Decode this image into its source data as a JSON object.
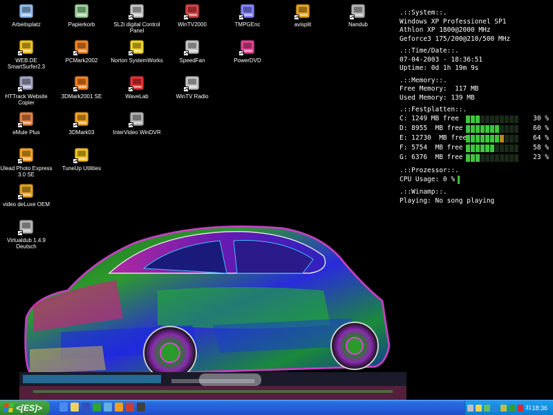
{
  "desktop_icons": [
    {
      "label": "Arbeitsplatz",
      "icon": "my-computer-icon",
      "color": "#8fb8e8"
    },
    {
      "label": "Papierkorb",
      "icon": "recycle-bin-icon",
      "color": "#9ad09a"
    },
    {
      "label": "SL2i digital Control Panel",
      "icon": "control-panel-icon",
      "color": "#c0c0c0"
    },
    {
      "label": "WinTV2000",
      "icon": "wintv-icon",
      "color": "#d04040"
    },
    {
      "label": "TMPGEnc",
      "icon": "tmpgenc-icon",
      "color": "#8080ff"
    },
    {
      "label": "avisplit",
      "icon": "avisplit-icon",
      "color": "#e0a020"
    },
    {
      "label": "Nandub",
      "icon": "nandub-icon",
      "color": "#b0b0b0"
    },
    {
      "label": "WEB.DE SmartSurfer2.3",
      "icon": "smartsurfer-icon",
      "color": "#f0c020"
    },
    {
      "label": "PCMark2002",
      "icon": "pcmark-icon",
      "color": "#f08020"
    },
    {
      "label": "Norton SystemWorks",
      "icon": "norton-icon",
      "color": "#f0d020"
    },
    {
      "label": "SpeedFan",
      "icon": "speedfan-icon",
      "color": "#c0c0c0"
    },
    {
      "label": "PowerDVD",
      "icon": "powerdvd-icon",
      "color": "#e04090"
    },
    {
      "label": "HTTrack Website Copier",
      "icon": "httrack-icon",
      "color": "#a0a0c0"
    },
    {
      "label": "3DMark2001 SE",
      "icon": "3dmark2001-icon",
      "color": "#f08020"
    },
    {
      "label": "WaveLab",
      "icon": "wavelab-icon",
      "color": "#e03030"
    },
    {
      "label": "WinTV Radio",
      "icon": "wintv-radio-icon",
      "color": "#c0c0c0"
    },
    {
      "label": "eMule Plus",
      "icon": "emule-icon",
      "color": "#e08040"
    },
    {
      "label": "3DMark03",
      "icon": "3dmark03-icon",
      "color": "#f0a020"
    },
    {
      "label": "InterVideo WinDVR",
      "icon": "windvr-icon",
      "color": "#b0b0b0"
    },
    {
      "label": "Ulead Photo Express 3.0 SE",
      "icon": "ulead-icon",
      "color": "#f0a020"
    },
    {
      "label": "TuneUp Utilities",
      "icon": "tuneup-icon",
      "color": "#f0c020"
    },
    {
      "label": "video deLuxe OEM",
      "icon": "video-deluxe-icon",
      "color": "#e0a020"
    },
    {
      "label": "Virtualdub 1.4.9 Deutsch",
      "icon": "virtualdub-icon",
      "color": "#b0b0b0"
    }
  ],
  "sysinfo": {
    "system_header": ".::System::.",
    "os": "Windows XP Professionel SP1",
    "cpu": "Athlon XP 1800@2000 MHz",
    "gpu": "Geforce3 175/200@210/500 MHz",
    "time_header": ".::Time/Date::.",
    "datetime": "07-04-2003 - 18:36:51",
    "uptime": "Uptime: 0d 1h 19m 9s",
    "memory_header": ".::Memory::.",
    "free_memory": "Free Memory:  117 MB",
    "used_memory": "Used Memory: 139 MB",
    "drives_header": ".::Festplatten::.",
    "drives": [
      {
        "label": "C: 1249 MB free",
        "percent_text": "30 %",
        "percent": 30
      },
      {
        "label": "D: 8955  MB free",
        "percent_text": "60 %",
        "percent": 60
      },
      {
        "label": "E: 12730  MB free",
        "percent_text": "64 %",
        "percent": 64
      },
      {
        "label": "F: 5754  MB free",
        "percent_text": "58 %",
        "percent": 58
      },
      {
        "label": "G: 6376  MB free",
        "percent_text": "23 %",
        "percent": 23
      }
    ],
    "cpu_header": ".::Prozessor::.",
    "cpu_usage": "CPU Usage: 0 %",
    "cpu_percent": 0,
    "winamp_header": ".::Winamp::.",
    "winamp_status": "Playing: No song playing"
  },
  "taskbar": {
    "start_label": "<[ES]>",
    "quick_launch": [
      {
        "icon": "ie-icon",
        "color": "#4a8af0"
      },
      {
        "icon": "folder-icon",
        "color": "#f0d060"
      },
      {
        "icon": "word-icon",
        "color": "#3050c0"
      },
      {
        "icon": "excel-icon",
        "color": "#30a040"
      },
      {
        "icon": "paint-icon",
        "color": "#60b0e0"
      },
      {
        "icon": "media-icon",
        "color": "#f0a020"
      },
      {
        "icon": "app-icon",
        "color": "#c04040"
      },
      {
        "icon": "terminal-icon",
        "color": "#404040"
      }
    ],
    "tray_icons": [
      {
        "icon": "tray-monitor-icon",
        "color": "#c0c0c0"
      },
      {
        "icon": "tray-network-icon",
        "color": "#f0d060"
      },
      {
        "icon": "tray-speaker-icon",
        "color": "#60c060"
      },
      {
        "icon": "tray-globe-icon",
        "color": "#3080e0"
      },
      {
        "icon": "tray-app-icon",
        "color": "#c0c040"
      },
      {
        "icon": "tray-nvidia-icon",
        "color": "#30a030"
      },
      {
        "icon": "tray-security-icon",
        "color": "#d03030"
      }
    ],
    "tray_label": "31",
    "clock": "18:36"
  }
}
